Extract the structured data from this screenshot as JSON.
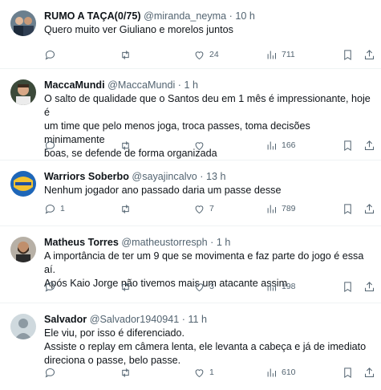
{
  "tweets": [
    {
      "name": "RUMO A TAÇA(0/75)",
      "handle": "@miranda_neyma",
      "time": "10 h",
      "lines": [
        "Quero muito ver Giuliano e morelos juntos"
      ],
      "replies": "",
      "retweets": "",
      "likes": "24",
      "views": "711"
    },
    {
      "name": "MaccaMundi",
      "handle": "@MaccaMundi",
      "time": "1 h",
      "lines": [
        "O salto de qualidade que o Santos deu em 1 mês é impressionante, hoje é",
        "um time que pelo menos joga, troca passes, toma decisões minimamente",
        "boas, se defende de forma organizada"
      ],
      "replies": "",
      "retweets": "",
      "likes": "",
      "views": "166"
    },
    {
      "name": "Warriors Soberbo",
      "handle": "@sayajincalvo",
      "time": "13 h",
      "lines": [
        "Nenhum jogador ano passado daria um passe desse"
      ],
      "replies": "1",
      "retweets": "",
      "likes": "7",
      "views": "789"
    },
    {
      "name": "Matheus Torres",
      "handle": "@matheustorresph",
      "time": "1 h",
      "lines": [
        "A importância de ter um 9 que se movimenta e faz parte do jogo é essa aí.",
        "Após Kaio Jorge não tivemos mais um atacante assim"
      ],
      "replies": "",
      "retweets": "",
      "likes": "3",
      "views": "198"
    },
    {
      "name": "Salvador",
      "handle": "@Salvador1940941",
      "time": "11 h",
      "lines": [
        "Ele viu, por isso é diferenciado.",
        "Assiste o replay em câmera lenta, ele levanta a cabeça e já de imediato",
        "direciona o passe, belo passe."
      ],
      "replies": "",
      "retweets": "",
      "likes": "1",
      "views": "610"
    }
  ],
  "separator": "·",
  "icons": {
    "reply": "reply-icon",
    "retweet": "retweet-icon",
    "like": "heart-icon",
    "views": "views-icon",
    "bookmark": "bookmark-icon",
    "share": "share-icon"
  },
  "colors": {
    "text": "#0f1419",
    "secondary": "#536471",
    "divider": "#eff3f4"
  }
}
